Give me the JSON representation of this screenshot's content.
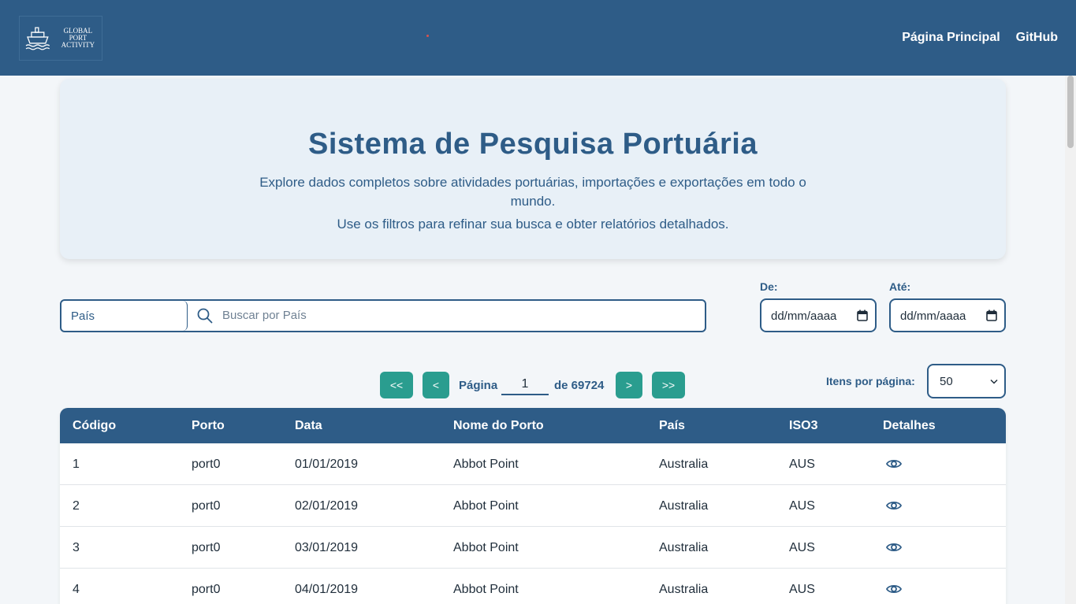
{
  "navbar": {
    "logo_text_line1": "GLOBAL PORT",
    "logo_text_line2": "ACTIVITY",
    "links": [
      "Página Principal",
      "GitHub"
    ]
  },
  "hero": {
    "title": "Sistema de Pesquisa Portuária",
    "description": "Explore dados completos sobre atividades portuárias, importações e exportações em todo o mundo.",
    "description2": "Use os filtros para refinar sua busca e obter relatórios detalhados."
  },
  "filters": {
    "country_select": "País",
    "search_placeholder": "Buscar por País",
    "from_label": "De:",
    "to_label": "Até:",
    "from_value": "dd/mm/aaaa",
    "to_value": "dd/mm/aaaa"
  },
  "pagination": {
    "first": "<<",
    "prev": "<",
    "next": ">",
    "last": ">>",
    "page_label": "Página",
    "current_page": "1",
    "of_label": "de 69724",
    "per_page_label": "Itens por página:",
    "per_page_value": "50"
  },
  "table": {
    "headers": [
      "Código",
      "Porto",
      "Data",
      "Nome do Porto",
      "País",
      "ISO3",
      "Detalhes"
    ],
    "rows": [
      [
        "1",
        "port0",
        "01/01/2019",
        "Abbot Point",
        "Australia",
        "AUS"
      ],
      [
        "2",
        "port0",
        "02/01/2019",
        "Abbot Point",
        "Australia",
        "AUS"
      ],
      [
        "3",
        "port0",
        "03/01/2019",
        "Abbot Point",
        "Australia",
        "AUS"
      ],
      [
        "4",
        "port0",
        "04/01/2019",
        "Abbot Point",
        "Australia",
        "AUS"
      ]
    ]
  },
  "colors": {
    "primary": "#2e5c87",
    "accent": "#2a9d8f",
    "hero_bg": "#e8f0f7",
    "page_bg": "#f3f6f9"
  },
  "icons": [
    "ship-logo-icon",
    "search-icon",
    "calendar-icon",
    "chevron-down-icon",
    "eye-icon"
  ]
}
